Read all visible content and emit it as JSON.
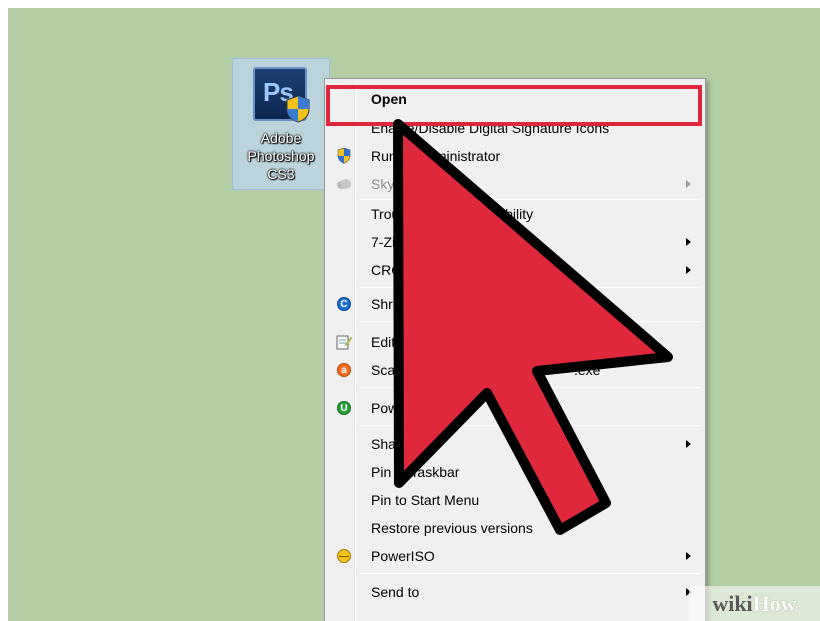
{
  "desktop_icon": {
    "tile_text": "Ps",
    "label_lines": [
      "Adobe",
      "Photoshop",
      "CS3"
    ],
    "icon": "photoshop-app-icon"
  },
  "context_menu": {
    "items": [
      {
        "label": "Open",
        "bold": true,
        "icon": ""
      },
      {
        "label": "Enable/Disable Digital Signature Icons",
        "icon": ""
      },
      {
        "label": "Run as administrator",
        "icon": "uac-shield-icon"
      },
      {
        "label": "SkyDrive",
        "icon": "cloud-icon",
        "disabled": true,
        "submenu": true
      },
      {
        "label": "Troubleshoot compatibility",
        "icon": ""
      },
      {
        "label": "7-Zip",
        "icon": "",
        "submenu": true
      },
      {
        "label": "CRC SHA",
        "icon": "",
        "submenu": true
      },
      {
        "label": "Shred",
        "icon": "ccleaner-icon"
      },
      {
        "label": "Edit",
        "icon": "notepad-icon"
      },
      {
        "label": "Scan",
        "icon": "avast-icon",
        "suffix": ".exe"
      },
      {
        "label": "Power",
        "icon": "powerup-icon"
      },
      {
        "label": "Share with",
        "icon": "",
        "submenu": true
      },
      {
        "label": "Pin to Taskbar",
        "icon": ""
      },
      {
        "label": "Pin to Start Menu",
        "icon": ""
      },
      {
        "label": "Restore previous versions",
        "icon": ""
      },
      {
        "label": "PowerISO",
        "icon": "poweriso-icon",
        "submenu": true
      },
      {
        "label": "Send to",
        "icon": "",
        "submenu": true
      }
    ],
    "highlight_color": "#e0263a"
  },
  "overlay": {
    "cursor_arrow_color": "#e0283c",
    "watermark": {
      "part1": "wiki",
      "part2": "How"
    }
  },
  "colors": {
    "desktop_background": "#b4cda5",
    "menu_background": "#f0f0f0"
  }
}
